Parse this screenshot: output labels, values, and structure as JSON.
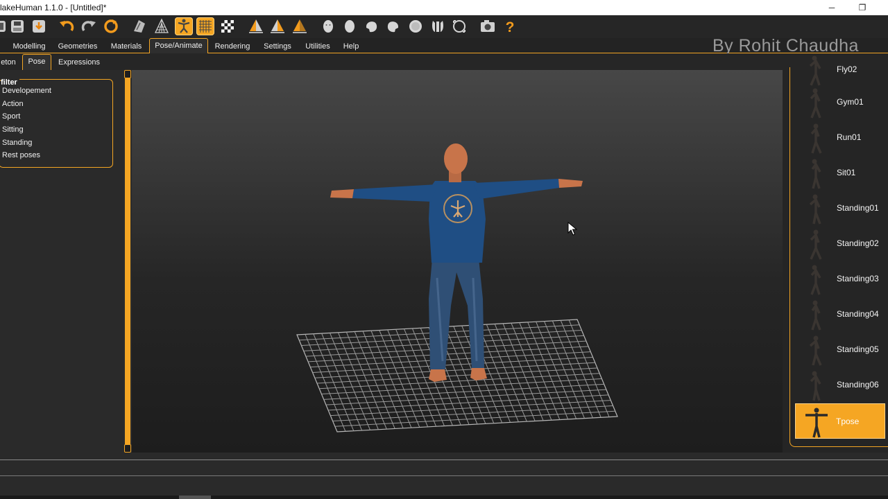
{
  "window": {
    "title": "lakeHuman 1.1.0 - [Untitled]*",
    "minimize_glyph": "─",
    "restore_glyph": "❐"
  },
  "toolbar": {
    "icons": [
      "grid-partial-icon",
      "save-icon",
      "load-icon",
      "undo-icon",
      "redo-icon",
      "reset-icon",
      "smooth-icon",
      "wireframe-icon",
      "pose-icon",
      "grid-icon",
      "checker-icon",
      "front-view-icon",
      "side-view-icon",
      "back-view-icon",
      "head-front-icon",
      "head-back-icon",
      "head-left-icon",
      "head-right-icon",
      "head-top-icon",
      "head-bottom-icon",
      "reset-camera-icon",
      "screenshot-icon",
      "help-icon"
    ],
    "active": [
      "pose-icon",
      "grid-icon"
    ]
  },
  "tabs": [
    "Modelling",
    "Geometries",
    "Materials",
    "Pose/Animate",
    "Rendering",
    "Settings",
    "Utilities",
    "Help"
  ],
  "selected_tab": "Pose/Animate",
  "subtabs": [
    "eton",
    "Pose",
    "Expressions"
  ],
  "selected_subtab": "Pose",
  "watermark": "By Rohit Chaudha",
  "filter": {
    "title": "filter",
    "items": [
      "Developement",
      "Action",
      "Sport",
      "Sitting",
      "Standing",
      "Rest poses"
    ]
  },
  "poses": {
    "items": [
      "Fly02",
      "Gym01",
      "Run01",
      "Sit01",
      "Standing01",
      "Standing02",
      "Standing03",
      "Standing04",
      "Standing05",
      "Standing06",
      "Tpose"
    ],
    "selected": "Tpose"
  },
  "colors": {
    "accent": "#f5a623",
    "background": "#2c2c2c",
    "shirt": "#1f4e84",
    "jeans": "#2f4f75",
    "skin": "#c8744a"
  }
}
